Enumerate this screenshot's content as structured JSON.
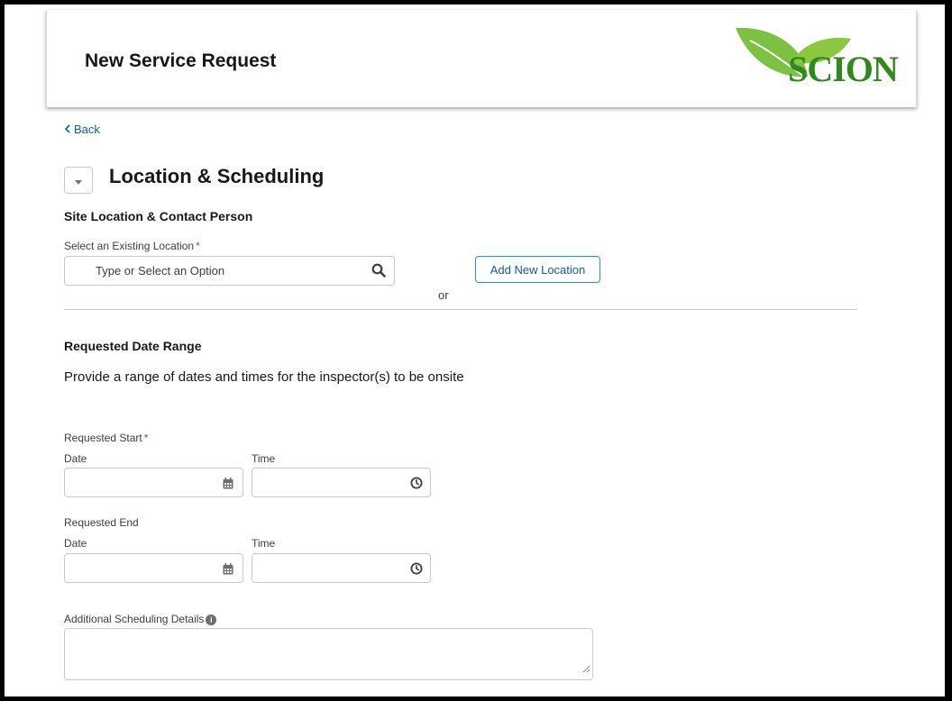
{
  "header": {
    "title": "New Service Request",
    "logo_text": "SCION"
  },
  "nav": {
    "back_label": "Back"
  },
  "section": {
    "title": "Location & Scheduling"
  },
  "site_location": {
    "heading": "Site Location & Contact Person",
    "select_label": "Select an Existing Location",
    "required_mark": "*",
    "select_placeholder": "Type or Select an Option",
    "or_text": "or",
    "add_button_label": "Add New Location"
  },
  "date_range": {
    "heading": "Requested Date Range",
    "help_text": "Provide a range of dates and times for the inspector(s) to be onsite",
    "start": {
      "label": "Requested Start",
      "required_mark": "*",
      "date_label": "Date",
      "time_label": "Time",
      "date_value": "",
      "time_value": ""
    },
    "end": {
      "label": "Requested End",
      "date_label": "Date",
      "time_label": "Time",
      "date_value": "",
      "time_value": ""
    }
  },
  "additional": {
    "label": "Additional Scheduling Details",
    "info_glyph": "i",
    "value": ""
  },
  "colors": {
    "link": "#0b5cab",
    "button_border": "#1b96d6",
    "required": "#c23934",
    "logo_green": "#2f8a1e"
  }
}
